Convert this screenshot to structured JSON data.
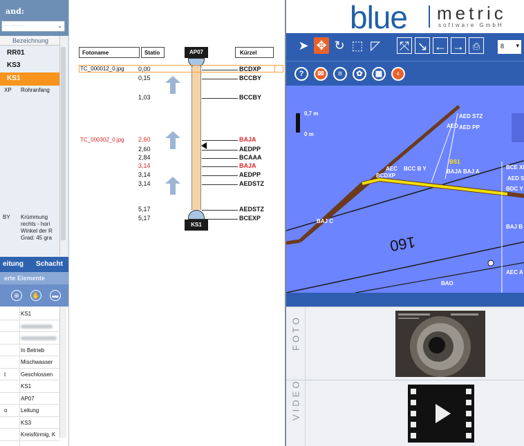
{
  "left_panel": {
    "title": "and:",
    "combo_value": "··· ········",
    "column_header": "Bezeichnung",
    "nodes": [
      "RR01",
      "KS3",
      "KS1"
    ],
    "selected_node": "KS1",
    "rohr_code": "XP",
    "rohr_label": "Rohranfang",
    "detail_code": "BY",
    "detail_text": "Krümmung rechts - hori Winkel der R Grad: 45 gra",
    "tab_leitung": "eitung",
    "tab_schacht": "Schacht",
    "section_title": "erte Elemente",
    "list_values": [
      "KS1",
      "",
      "",
      "In Betrieb",
      "Mischwasser",
      "Geschlossen",
      "KS1",
      "AP07",
      "Leitung",
      "KS3",
      "Kreisförmig, K"
    ],
    "list_prefixes": [
      "",
      "",
      "",
      "",
      "",
      "t",
      "",
      "",
      "o",
      "",
      ""
    ]
  },
  "diagram": {
    "headers": {
      "photo": "Fotoname",
      "station": "Statio",
      "code": "Kürzel"
    },
    "top_node": "AP07",
    "bottom_node": "KS1",
    "photos": [
      {
        "name": "TC_000012_0.jpg",
        "highlight": "orange"
      },
      {
        "name": "TC_000302_0.jpg",
        "highlight": "red"
      }
    ],
    "rows": [
      {
        "station": "0,00",
        "code": "BCDXP",
        "red": false
      },
      {
        "station": "0,15",
        "code": "BCCBY",
        "red": false
      },
      {
        "station": "1,03",
        "code": "BCCBY",
        "red": false
      },
      {
        "station": "2,60",
        "code": "BAJA",
        "red": true
      },
      {
        "station": "2,60",
        "code": "AEDPP",
        "red": false
      },
      {
        "station": "2,84",
        "code": "BCAAA",
        "red": false
      },
      {
        "station": "3,14",
        "code": "BAJA",
        "red": true
      },
      {
        "station": "3,14",
        "code": "AEDPP",
        "red": false
      },
      {
        "station": "3,14",
        "code": "AEDSTZ",
        "red": false
      },
      {
        "station": "5,17",
        "code": "AEDSTZ",
        "red": false
      },
      {
        "station": "5,17",
        "code": "BCEXP",
        "red": false
      }
    ]
  },
  "right_panel": {
    "logo_blue": "blue",
    "logo_metric": "metric",
    "logo_sub": "software GmbH",
    "zoom_value": "8",
    "toolbar_top_icons": [
      "pointer-icon",
      "move-icon",
      "rotate-icon",
      "select-box-icon",
      "angle-icon",
      "fit-icon",
      "zoom-region-icon",
      "left-arrow-icon",
      "right-arrow-icon",
      "print-icon"
    ],
    "toolbar_bottom_icons": [
      "help-icon",
      "mail-icon",
      "list-icon",
      "palette-icon",
      "layers-icon",
      "back-icon"
    ],
    "scale_top": "0,7 m",
    "scale_bottom": "0 m",
    "view_labels": [
      "AED STZ",
      "AED",
      "AED PP",
      "BCC B Y",
      "AEC",
      "BCDXP",
      "BAJA",
      "BS1",
      "BAJ A",
      "BCE XP",
      "AED S",
      "BDC Y",
      "BAJ C",
      "BAJ B",
      "AEC A",
      "BAO",
      "160"
    ],
    "foto_label": "FOTO",
    "video_label": "VIDEO"
  }
}
